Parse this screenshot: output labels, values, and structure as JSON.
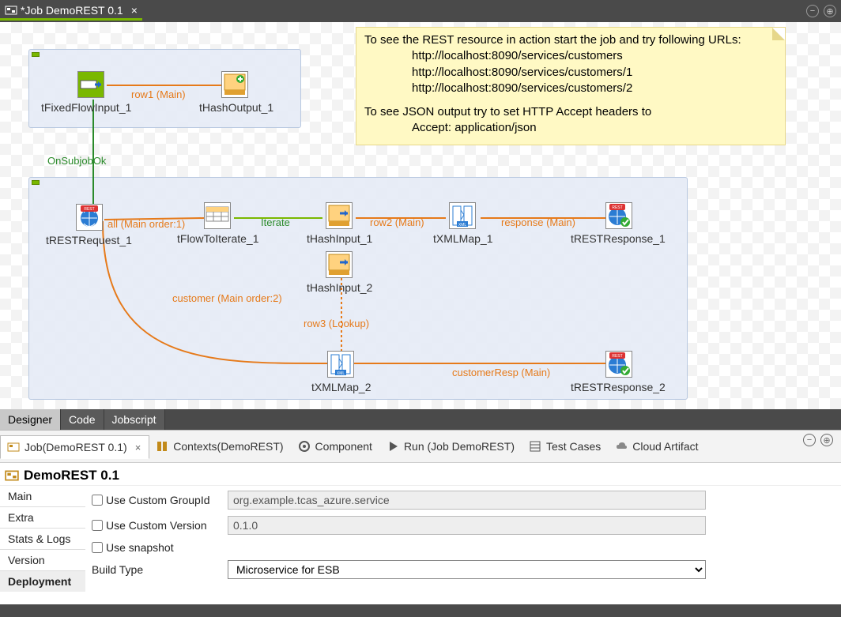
{
  "tab": {
    "title": "*Job DemoREST 0.1"
  },
  "note": {
    "line1": "To see the REST resource in action start the job and try following URLs:",
    "url1": "http://localhost:8090/services/customers",
    "url2": "http://localhost:8090/services/customers/1",
    "url3": "http://localhost:8090/services/customers/2",
    "line2": "To see JSON output try to set HTTP Accept headers to",
    "accept": "Accept: application/json"
  },
  "nodes": {
    "fixedflow": "tFixedFlowInput_1",
    "hashout": "tHashOutput_1",
    "restreq": "tRESTRequest_1",
    "flowiter": "tFlowToIterate_1",
    "hashin1": "tHashInput_1",
    "hashin2": "tHashInput_2",
    "xmlmap1": "tXMLMap_1",
    "xmlmap2": "tXMLMap_2",
    "restresp1": "tRESTResponse_1",
    "restresp2": "tRESTResponse_2"
  },
  "links": {
    "row1": "row1 (Main)",
    "onok": "OnSubjobOk",
    "all": "all (Main order:1)",
    "iterate": "Iterate",
    "row2": "row2 (Main)",
    "response": "response (Main)",
    "customer": "customer (Main order:2)",
    "row3": "row3 (Lookup)",
    "custresp": "customerResp (Main)"
  },
  "editorTabs": {
    "designer": "Designer",
    "code": "Code",
    "jobscript": "Jobscript"
  },
  "propTabs": {
    "job": "Job(DemoREST 0.1)",
    "contexts": "Contexts(DemoREST)",
    "component": "Component",
    "run": "Run (Job DemoREST)",
    "testcases": "Test Cases",
    "cloud": "Cloud Artifact"
  },
  "jobTitle": "DemoREST 0.1",
  "sideTabs": {
    "main": "Main",
    "extra": "Extra",
    "stats": "Stats & Logs",
    "version": "Version",
    "deploy": "Deployment"
  },
  "form": {
    "useGroup": "Use Custom GroupId",
    "groupVal": "org.example.tcas_azure.service",
    "useVer": "Use Custom Version",
    "verVal": "0.1.0",
    "snapshot": "Use snapshot",
    "buildType": "Build Type",
    "buildVal": "Microservice for ESB"
  }
}
